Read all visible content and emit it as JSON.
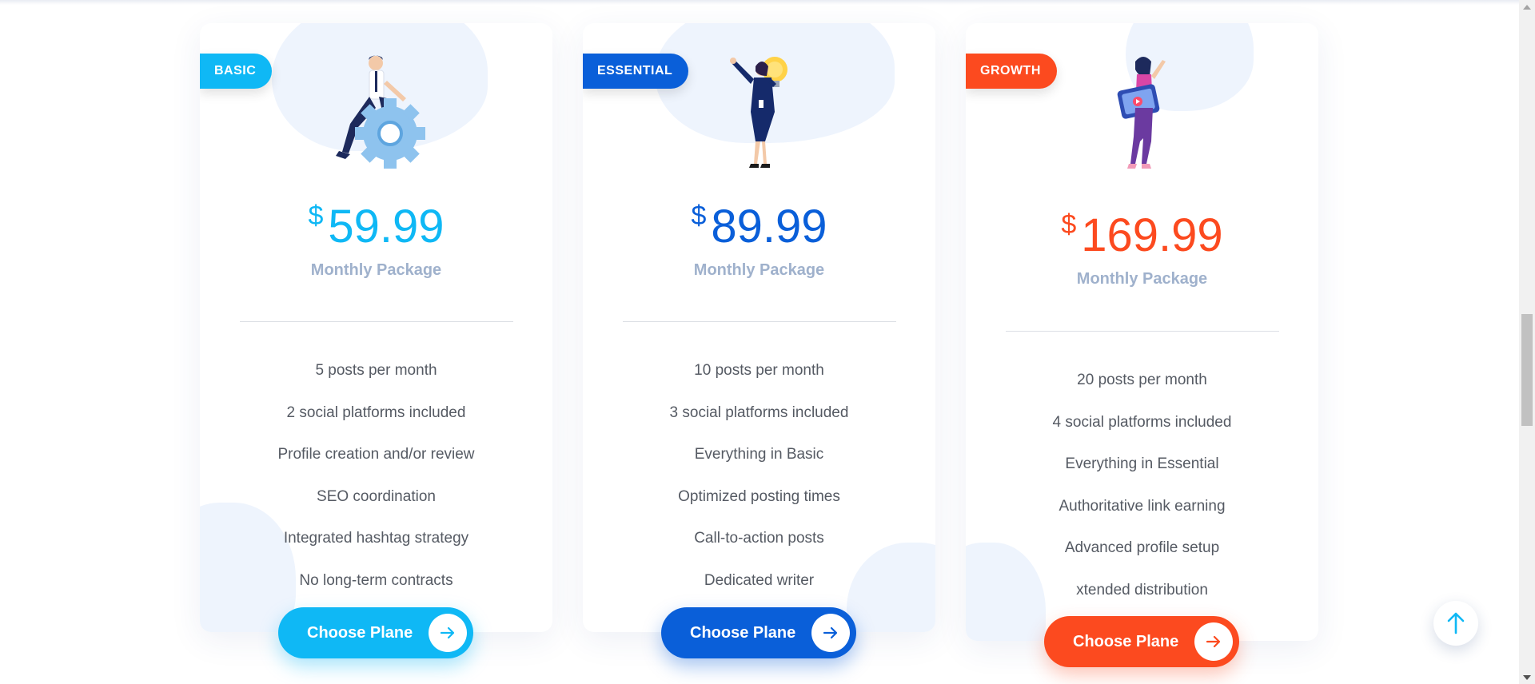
{
  "plans": [
    {
      "badge": "BASIC",
      "currency": "$",
      "price": "59.99",
      "period": "Monthly Package",
      "color": "#0fb8f5",
      "features": [
        "5 posts per month",
        "2 social platforms included",
        "Profile creation and/or review",
        "SEO coordination",
        "Integrated hashtag strategy",
        "No long-term contracts"
      ],
      "button_label": "Choose Plane",
      "illustration_icon": "man-with-gear-illustration"
    },
    {
      "badge": "ESSENTIAL",
      "currency": "$",
      "price": "89.99",
      "period": "Monthly Package",
      "color": "#0a5fd9",
      "features": [
        "10 posts per month",
        "3 social platforms included",
        "Everything in Basic",
        "Optimized posting times",
        "Call-to-action posts",
        "Dedicated writer"
      ],
      "button_label": "Choose Plane",
      "illustration_icon": "woman-with-lightbulb-illustration"
    },
    {
      "badge": "GROWTH",
      "currency": "$",
      "price": "169.99",
      "period": "Monthly Package",
      "color": "#fc4a1f",
      "features": [
        "20 posts per month",
        "4 social platforms included",
        "Everything in Essential",
        "Authoritative link earning",
        "Advanced profile setup",
        "xtended distribution"
      ],
      "button_label": "Choose Plane",
      "illustration_icon": "woman-with-tablet-illustration"
    }
  ],
  "scroll_top_icon": "arrow-up-icon",
  "scroll_top_color": "#0fb8f5"
}
